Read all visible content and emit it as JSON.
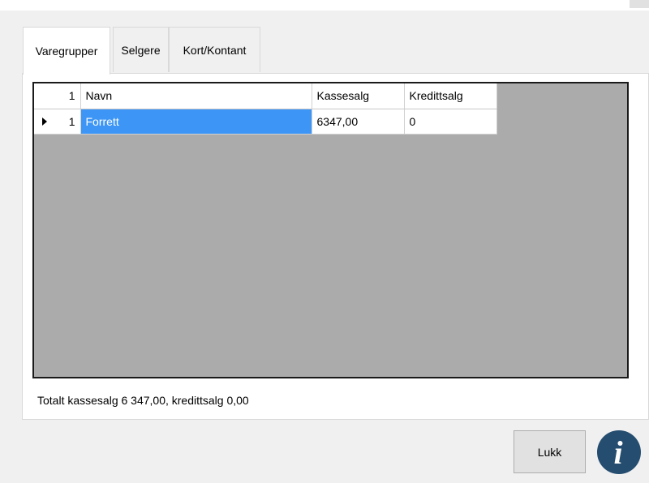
{
  "tabs": [
    {
      "label": "Varegrupper",
      "active": true
    },
    {
      "label": "Selgere",
      "active": false
    },
    {
      "label": "Kort/Kontant",
      "active": false
    }
  ],
  "grid": {
    "header": {
      "row_count": "1",
      "columns": [
        "Navn",
        "Kassesalg",
        "Kredittsalg"
      ]
    },
    "rows": [
      {
        "num": "1",
        "navn": "Forrett",
        "kassesalg": "6347,00",
        "kredittsalg": "0"
      }
    ],
    "selected_cell_color": "#3d96f5"
  },
  "summary": "Totalt kassesalg 6 347,00, kredittsalg 0,00",
  "close_label": "Lukk",
  "info_icon": {
    "name": "info-icon",
    "glyph": "i",
    "color": "#254d6f"
  }
}
